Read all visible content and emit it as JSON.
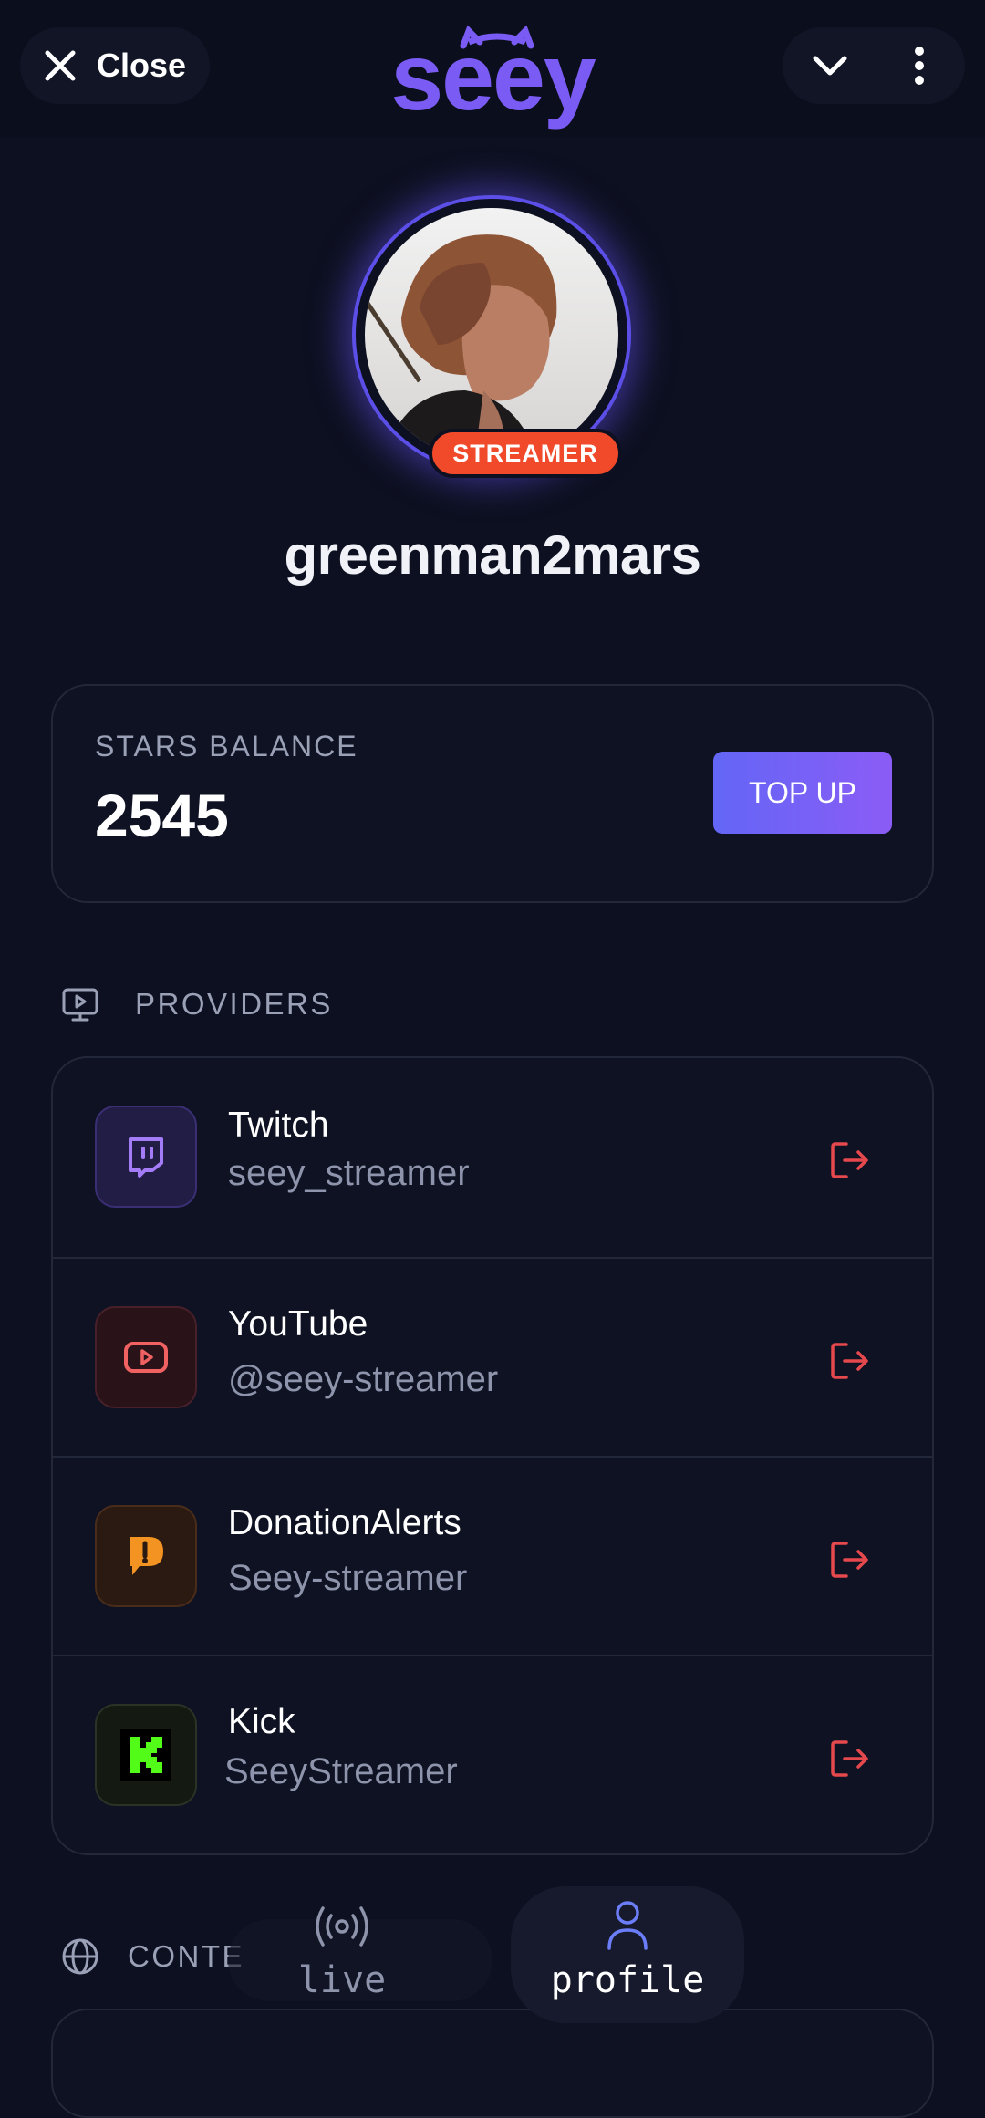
{
  "header": {
    "close_label": "Close",
    "logo_text": "seey"
  },
  "profile": {
    "role_badge": "STREAMER",
    "username": "greenman2mars"
  },
  "balance": {
    "label": "STARS BALANCE",
    "value": "2545",
    "topup_label": "TOP UP"
  },
  "providers": {
    "section_label": "PROVIDERS",
    "items": [
      {
        "name": "Twitch",
        "handle": "seey_streamer",
        "icon": "twitch-icon"
      },
      {
        "name": "YouTube",
        "handle": "@seey-streamer",
        "icon": "youtube-icon"
      },
      {
        "name": "DonationAlerts",
        "handle": "Seey-streamer",
        "icon": "donationalerts-icon"
      },
      {
        "name": "Kick",
        "handle": "SeeyStreamer",
        "icon": "kick-icon"
      }
    ]
  },
  "content_section": {
    "section_label": "CONTE"
  },
  "nav": {
    "live_label": "live",
    "profile_label": "profile"
  },
  "colors": {
    "background": "#0d1020",
    "accent": "#7a5cf4",
    "badge": "#f04a2a",
    "logout": "#e5484d"
  }
}
